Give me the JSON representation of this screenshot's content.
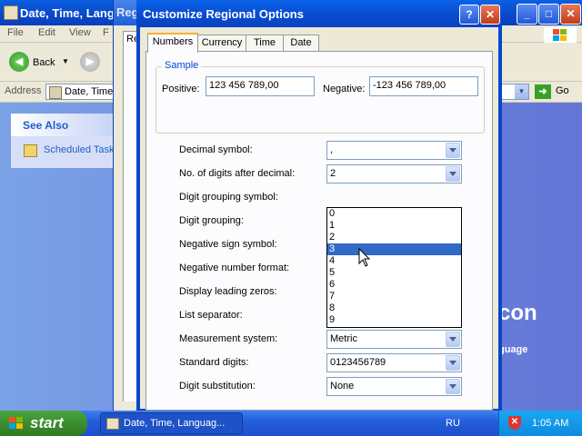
{
  "background_window": {
    "title": "Date, Time, Lang",
    "menu": [
      "File",
      "Edit",
      "View",
      "F"
    ],
    "toolbar": {
      "back_label": "Back"
    },
    "address": {
      "label": "Address",
      "value": "Date, Time",
      "go_label": "Go"
    },
    "see_also": {
      "title": "See Also",
      "link": "Scheduled Task"
    },
    "right_text": {
      "icon_text": "con",
      "lang_text": "guage"
    }
  },
  "regional_window": {
    "title": "Reg",
    "tab_label": "Re"
  },
  "dialog": {
    "title": "Customize Regional Options",
    "help_glyph": "?",
    "tabs": [
      {
        "label": "Numbers",
        "active": true
      },
      {
        "label": "Currency",
        "active": false
      },
      {
        "label": "Time",
        "active": false
      },
      {
        "label": "Date",
        "active": false
      }
    ],
    "sample": {
      "legend": "Sample",
      "positive_label": "Positive:",
      "positive_value": "123 456 789,00",
      "negative_label": "Negative:",
      "negative_value": "-123 456 789,00"
    },
    "rows": [
      {
        "label": "Decimal symbol:",
        "value": ","
      },
      {
        "label": "No. of digits after decimal:",
        "value": "2"
      },
      {
        "label": "Digit grouping symbol:",
        "value": ""
      },
      {
        "label": "Digit grouping:",
        "value": ""
      },
      {
        "label": "Negative sign symbol:",
        "value": ""
      },
      {
        "label": "Negative number format:",
        "value": ""
      },
      {
        "label": "Display leading zeros:",
        "value": ""
      },
      {
        "label": "List separator:",
        "value": ";"
      },
      {
        "label": "Measurement system:",
        "value": "Metric"
      },
      {
        "label": "Standard digits:",
        "value": "0123456789"
      },
      {
        "label": "Digit substitution:",
        "value": "None"
      }
    ],
    "dropdown": {
      "options": [
        "0",
        "1",
        "2",
        "3",
        "4",
        "5",
        "6",
        "7",
        "8",
        "9"
      ],
      "highlighted": "3"
    }
  },
  "taskbar": {
    "start_label": "start",
    "task_item": "Date, Time, Languag...",
    "language": "RU",
    "clock": "1:05 AM"
  },
  "colors": {
    "titlebar": "#0a5fe0",
    "selection": "#316ac5",
    "start_button": "#3c8d2f",
    "sample_legend": "#0046d5",
    "link": "#215dc6"
  }
}
